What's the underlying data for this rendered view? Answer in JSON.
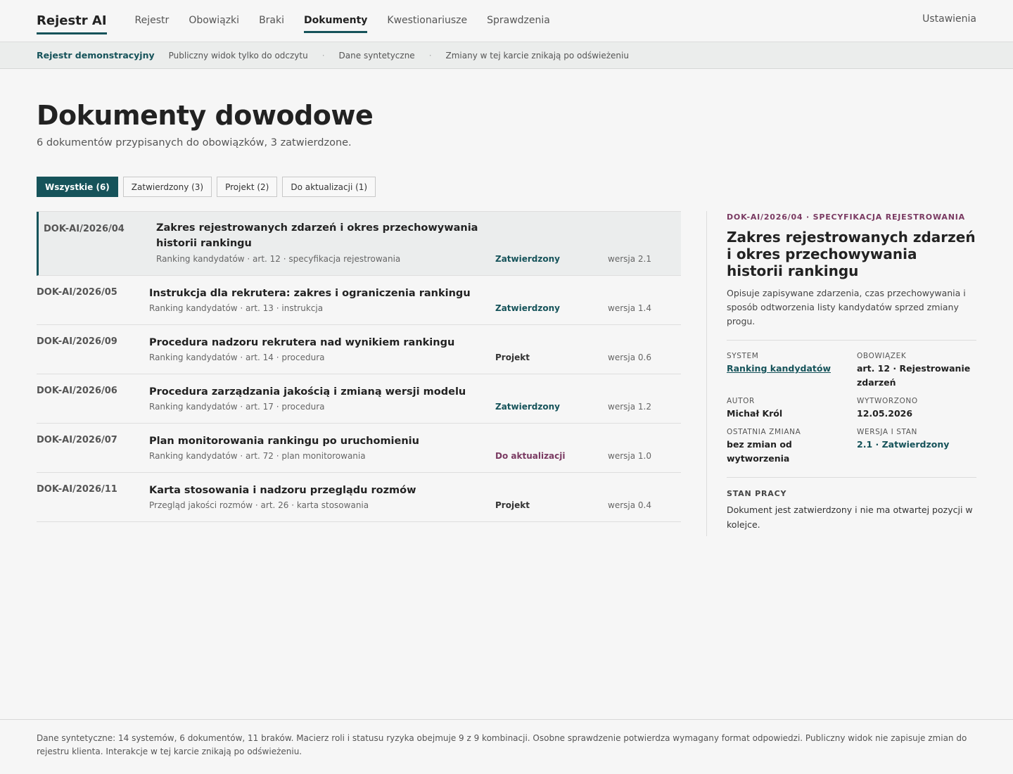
{
  "nav": {
    "brand": "Rejestr AI",
    "links": [
      "Rejestr",
      "Obowiązki",
      "Braki",
      "Dokumenty",
      "Kwestionariusze",
      "Sprawdzenia"
    ],
    "active_index": 3,
    "settings": "Ustawienia"
  },
  "banner": {
    "name": "Rejestr demonstracyjny",
    "items": [
      "Publiczny widok tylko do odczytu",
      "Dane syntetyczne",
      "Zmiany w tej karcie znikają po odświeżeniu"
    ],
    "separator": "·"
  },
  "page": {
    "title": "Dokumenty dowodowe",
    "subtitle": "6 dokumentów przypisanych do obowiązków, 3 zatwierdzone."
  },
  "filters": [
    {
      "label": "Wszystkie (6)",
      "active": true
    },
    {
      "label": "Zatwierdzony (3)",
      "active": false
    },
    {
      "label": "Projekt (2)",
      "active": false
    },
    {
      "label": "Do aktualizacji (1)",
      "active": false
    }
  ],
  "documents": [
    {
      "id": "DOK-AI/2026/04",
      "title": "Zakres rejestrowanych zdarzeń i okres przechowywania historii rankingu",
      "meta": "Ranking kandydatów · art. 12 · specyfikacja rejestrowania",
      "status": "Zatwierdzony",
      "status_type": "approved",
      "version": "wersja 2.1",
      "selected": true
    },
    {
      "id": "DOK-AI/2026/05",
      "title": "Instrukcja dla rekrutera: zakres i ograniczenia rankingu",
      "meta": "Ranking kandydatów · art. 13 · instrukcja",
      "status": "Zatwierdzony",
      "status_type": "approved",
      "version": "wersja 1.4",
      "selected": false
    },
    {
      "id": "DOK-AI/2026/09",
      "title": "Procedura nadzoru rekrutera nad wynikiem rankingu",
      "meta": "Ranking kandydatów · art. 14 · procedura",
      "status": "Projekt",
      "status_type": "project",
      "version": "wersja 0.6",
      "selected": false
    },
    {
      "id": "DOK-AI/2026/06",
      "title": "Procedura zarządzania jakością i zmianą wersji modelu",
      "meta": "Ranking kandydatów · art. 17 · procedura",
      "status": "Zatwierdzony",
      "status_type": "approved",
      "version": "wersja 1.2",
      "selected": false
    },
    {
      "id": "DOK-AI/2026/07",
      "title": "Plan monitorowania rankingu po uruchomieniu",
      "meta": "Ranking kandydatów · art. 72 · plan monitorowania",
      "status": "Do aktualizacji",
      "status_type": "update",
      "version": "wersja 1.0",
      "selected": false
    },
    {
      "id": "DOK-AI/2026/11",
      "title": "Karta stosowania i nadzoru przeglądu rozmów",
      "meta": "Przegląd jakości rozmów · art. 26 · karta stosowania",
      "status": "Projekt",
      "status_type": "project",
      "version": "wersja 0.4",
      "selected": false
    }
  ],
  "detail": {
    "kicker": "DOK-AI/2026/04 · SPECYFIKACJA REJESTROWANIA",
    "title": "Zakres rejestrowanych zdarzeń i okres przechowywania historii rankingu",
    "description": "Opisuje zapisywane zdarzenia, czas przechowywania i sposób odtworzenia listy kandydatów sprzed zmiany progu.",
    "fields": {
      "system_label": "SYSTEM",
      "system_value": "Ranking kandydatów",
      "duty_label": "OBOWIĄZEK",
      "duty_value": "art. 12 · Rejestrowanie zdarzeń",
      "author_label": "AUTOR",
      "author_value": "Michał Król",
      "created_label": "WYTWORZONO",
      "created_value": "12.05.2026",
      "changed_label": "OSTATNIA ZMIANA",
      "changed_value": "bez zmian od wytworzenia",
      "version_label": "WERSJA I STAN",
      "version_value": "2.1 · Zatwierdzony"
    },
    "work_state_label": "STAN PRACY",
    "work_state_text": "Dokument jest zatwierdzony i nie ma otwartej pozycji w kolejce."
  },
  "footer": {
    "text": "Dane syntetyczne: 14 systemów, 6 dokumentów, 11 braków. Macierz roli i statusu ryzyka obejmuje 9 z 9 kombinacji. Osobne sprawdzenie potwierdza wymagany format odpowiedzi. Publiczny widok nie zapisuje zmian do rejestru klienta. Interakcje w tej karcie znikają po odświeżeniu."
  },
  "colors": {
    "accent": "#16535a",
    "update": "#7a3a62",
    "background": "#f6f6f6"
  }
}
